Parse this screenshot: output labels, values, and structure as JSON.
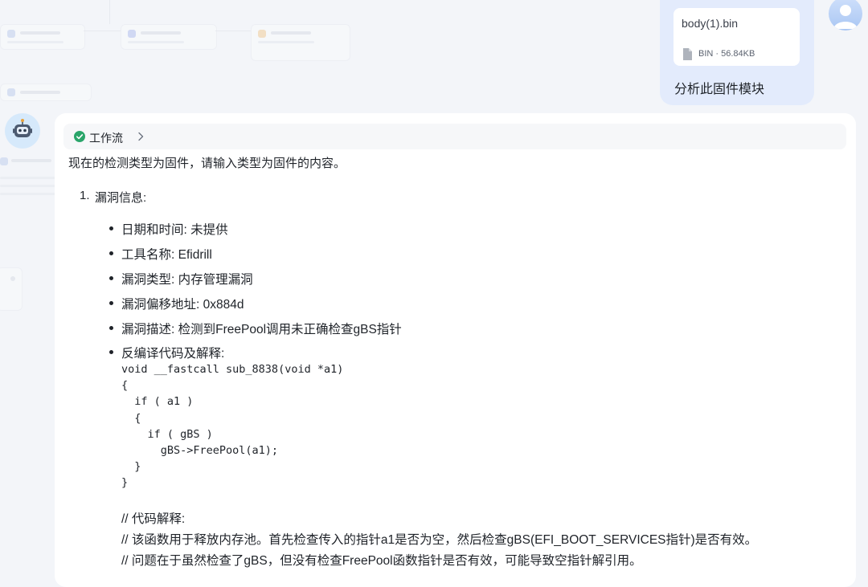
{
  "upload": {
    "file_name": "body(1).bin",
    "file_type": "BIN",
    "file_size": "56.84KB",
    "message": "分析此固件模块"
  },
  "assistant": {
    "workflow_label": "工作流",
    "intro": "现在的检测类型为固件，请输入类型为固件的内容。",
    "section_number": "1.",
    "section_title": "漏洞信息:",
    "details": [
      {
        "text": "日期和时间: 未提供"
      },
      {
        "text": "工具名称: Efidrill"
      },
      {
        "text": "漏洞类型: 内存管理漏洞"
      },
      {
        "text": "漏洞偏移地址: 0x884d"
      },
      {
        "text": "漏洞描述: 检测到FreePool调用未正确检查gBS指针"
      },
      {
        "text": "反编译代码及解释:"
      }
    ],
    "code": "void __fastcall sub_8838(void *a1)\n{\n  if ( a1 )\n  {\n    if ( gBS )\n      gBS->FreePool(a1);\n  }\n}",
    "comments": [
      "// 代码解释:",
      "// 该函数用于释放内存池。首先检查传入的指针a1是否为空，然后检查gBS(EFI_BOOT_SERVICES指针)是否有效。",
      "// 问题在于虽然检查了gBS，但没有检查FreePool函数指针是否有效，可能导致空指针解引用。"
    ]
  },
  "icons": {
    "file": "document-icon",
    "workflow_status": "check-circle-icon",
    "expand": "chevron-right-icon",
    "user": "user-avatar-icon",
    "bot": "robot-avatar-icon"
  },
  "colors": {
    "page_background": "#f3f5f9",
    "user_bubble": "#e3ebfc",
    "success_green": "#2aa56a",
    "card_background": "#ffffff"
  }
}
